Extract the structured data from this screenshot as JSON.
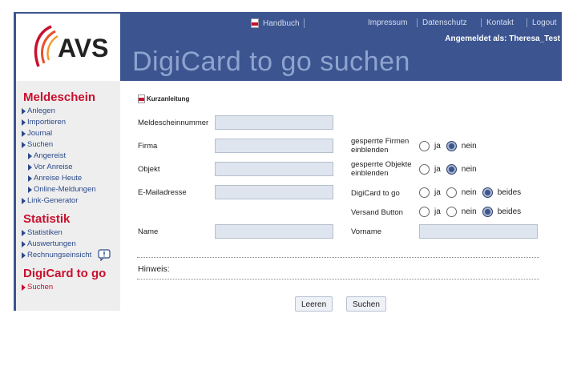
{
  "header": {
    "handbuch_label": "Handbuch",
    "links": [
      "Impressum",
      "Datenschutz",
      "Kontakt",
      "Logout"
    ],
    "user_line": "Angemeldet als: Theresa_Test",
    "page_title": "DigiCard to go suchen",
    "logo_text": "AVS"
  },
  "sidebar": {
    "sections": [
      {
        "title": "Meldeschein",
        "items": [
          "Anlegen",
          "Importieren",
          "Journal",
          "Suchen"
        ],
        "subitems": [
          "Angereist",
          "Vor Anreise",
          "Anreise Heute",
          "Online-Meldungen"
        ],
        "after": [
          "Link-Generator"
        ]
      },
      {
        "title": "Statistik",
        "items": [
          "Statistiken",
          "Auswertungen",
          "Rechnungseinsicht"
        ]
      },
      {
        "title": "DigiCard to go",
        "items": [
          "Suchen"
        ]
      }
    ]
  },
  "form": {
    "kurzanleitung": "Kurzanleitung",
    "meldescheinnummer": "Meldescheinnummer",
    "firma": "Firma",
    "objekt": "Objekt",
    "email": "E-Mailadresse",
    "name": "Name",
    "vorname": "Vorname",
    "gesperrte_firmen": [
      "gesperrte Firmen",
      "einblenden"
    ],
    "gesperrte_objekte": [
      "gesperrte Objekte",
      "einblenden"
    ],
    "digicard": "DigiCard to go",
    "versand": "Versand Button",
    "opt_ja": "ja",
    "opt_nein": "nein",
    "opt_beides": "beides",
    "hinweis": "Hinweis:"
  },
  "buttons": {
    "leeren": "Leeren",
    "suchen": "Suchen"
  },
  "colors": {
    "header_bg": "#3c5590",
    "title_color": "#8ea3cf",
    "accent_red": "#c8102e",
    "link_blue": "#2b4a8a"
  }
}
